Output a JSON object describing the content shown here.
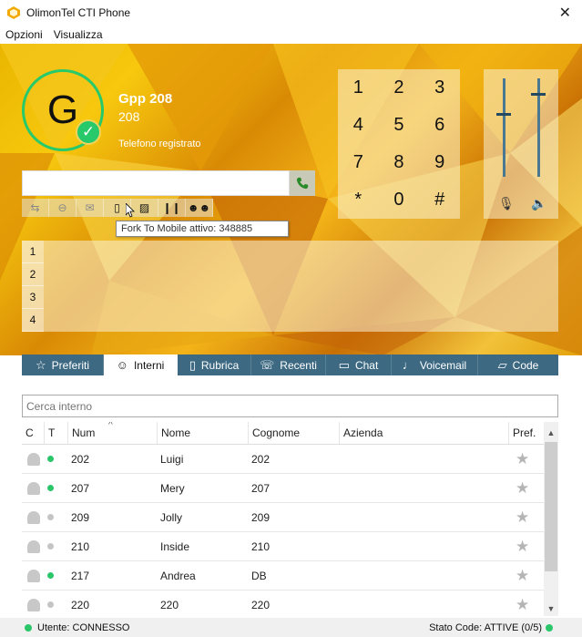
{
  "window": {
    "title": "OlimonTel CTI Phone",
    "close_glyph": "✕"
  },
  "menu": {
    "items": [
      "Opzioni",
      "Visualizza"
    ]
  },
  "user": {
    "initial": "G",
    "name": "Gpp 208",
    "extension": "208",
    "status": "Telefono registrato"
  },
  "dial": {
    "value": "",
    "placeholder": ""
  },
  "toolbar": {
    "icons": [
      "transfer-icon",
      "dnd-icon",
      "mail-icon",
      "mobile-icon",
      "image-icon",
      "pause-icon",
      "conference-icon"
    ],
    "tooltip": "Fork To Mobile attivo: 348885"
  },
  "keypad": {
    "keys": [
      "1",
      "2",
      "3",
      "4",
      "5",
      "6",
      "7",
      "8",
      "9",
      "*",
      "0",
      "#"
    ]
  },
  "volume": {
    "mic_level": 0.65,
    "speaker_level": 0.85
  },
  "lines": [
    "1",
    "2",
    "3",
    "4"
  ],
  "tabs": [
    {
      "label": "Preferiti",
      "icon": "star-icon",
      "glyph": "☆"
    },
    {
      "label": "Interni",
      "icon": "users-icon",
      "glyph": "☺"
    },
    {
      "label": "Rubrica",
      "icon": "book-icon",
      "glyph": "▯"
    },
    {
      "label": "Recenti",
      "icon": "recent-calls-icon",
      "glyph": "☏"
    },
    {
      "label": "Chat",
      "icon": "chat-icon",
      "glyph": "▭"
    },
    {
      "label": "Voicemail",
      "icon": "microphone-icon",
      "glyph": "♩"
    },
    {
      "label": "Code",
      "icon": "queue-icon",
      "glyph": "▱"
    }
  ],
  "active_tab": "Interni",
  "search": {
    "placeholder": "Cerca interno"
  },
  "table": {
    "columns": [
      "C",
      "T",
      "Num",
      "Nome",
      "Cognome",
      "Azienda",
      "Pref."
    ],
    "rows": [
      {
        "num": "202",
        "nome": "Luigi",
        "cognome": "202",
        "azienda": "",
        "online": true
      },
      {
        "num": "207",
        "nome": "Mery",
        "cognome": "207",
        "azienda": "",
        "online": true
      },
      {
        "num": "209",
        "nome": "Jolly",
        "cognome": "209",
        "azienda": "",
        "online": false
      },
      {
        "num": "210",
        "nome": "Inside",
        "cognome": "210",
        "azienda": "",
        "online": false
      },
      {
        "num": "217",
        "nome": "Andrea",
        "cognome": "DB",
        "azienda": "",
        "online": true
      },
      {
        "num": "220",
        "nome": "220",
        "cognome": "220",
        "azienda": "",
        "online": false
      }
    ]
  },
  "status": {
    "left": "Utente: CONNESSO",
    "right": "Stato Code: ATTIVE (0/5)"
  },
  "colors": {
    "online": "#2bc66a",
    "offline": "#c4c4c4",
    "tabbar": "#3d6a82",
    "accent": "#27c96a"
  }
}
